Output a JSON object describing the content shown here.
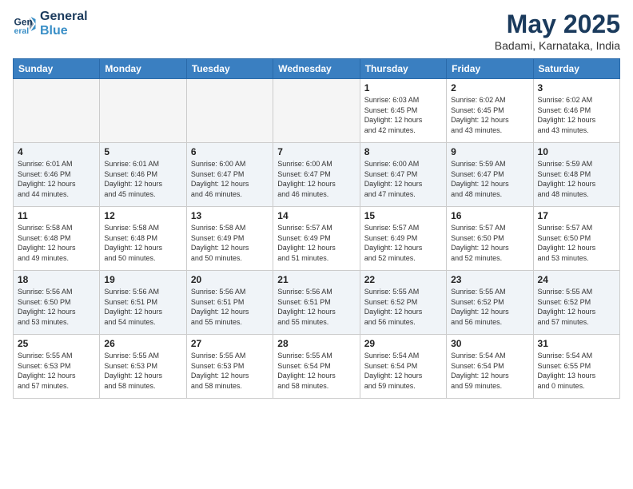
{
  "header": {
    "logo_line1": "General",
    "logo_line2": "Blue",
    "month": "May 2025",
    "location": "Badami, Karnataka, India"
  },
  "weekdays": [
    "Sunday",
    "Monday",
    "Tuesday",
    "Wednesday",
    "Thursday",
    "Friday",
    "Saturday"
  ],
  "weeks": [
    [
      {
        "day": "",
        "info": ""
      },
      {
        "day": "",
        "info": ""
      },
      {
        "day": "",
        "info": ""
      },
      {
        "day": "",
        "info": ""
      },
      {
        "day": "1",
        "info": "Sunrise: 6:03 AM\nSunset: 6:45 PM\nDaylight: 12 hours\nand 42 minutes."
      },
      {
        "day": "2",
        "info": "Sunrise: 6:02 AM\nSunset: 6:45 PM\nDaylight: 12 hours\nand 43 minutes."
      },
      {
        "day": "3",
        "info": "Sunrise: 6:02 AM\nSunset: 6:46 PM\nDaylight: 12 hours\nand 43 minutes."
      }
    ],
    [
      {
        "day": "4",
        "info": "Sunrise: 6:01 AM\nSunset: 6:46 PM\nDaylight: 12 hours\nand 44 minutes."
      },
      {
        "day": "5",
        "info": "Sunrise: 6:01 AM\nSunset: 6:46 PM\nDaylight: 12 hours\nand 45 minutes."
      },
      {
        "day": "6",
        "info": "Sunrise: 6:00 AM\nSunset: 6:47 PM\nDaylight: 12 hours\nand 46 minutes."
      },
      {
        "day": "7",
        "info": "Sunrise: 6:00 AM\nSunset: 6:47 PM\nDaylight: 12 hours\nand 46 minutes."
      },
      {
        "day": "8",
        "info": "Sunrise: 6:00 AM\nSunset: 6:47 PM\nDaylight: 12 hours\nand 47 minutes."
      },
      {
        "day": "9",
        "info": "Sunrise: 5:59 AM\nSunset: 6:47 PM\nDaylight: 12 hours\nand 48 minutes."
      },
      {
        "day": "10",
        "info": "Sunrise: 5:59 AM\nSunset: 6:48 PM\nDaylight: 12 hours\nand 48 minutes."
      }
    ],
    [
      {
        "day": "11",
        "info": "Sunrise: 5:58 AM\nSunset: 6:48 PM\nDaylight: 12 hours\nand 49 minutes."
      },
      {
        "day": "12",
        "info": "Sunrise: 5:58 AM\nSunset: 6:48 PM\nDaylight: 12 hours\nand 50 minutes."
      },
      {
        "day": "13",
        "info": "Sunrise: 5:58 AM\nSunset: 6:49 PM\nDaylight: 12 hours\nand 50 minutes."
      },
      {
        "day": "14",
        "info": "Sunrise: 5:57 AM\nSunset: 6:49 PM\nDaylight: 12 hours\nand 51 minutes."
      },
      {
        "day": "15",
        "info": "Sunrise: 5:57 AM\nSunset: 6:49 PM\nDaylight: 12 hours\nand 52 minutes."
      },
      {
        "day": "16",
        "info": "Sunrise: 5:57 AM\nSunset: 6:50 PM\nDaylight: 12 hours\nand 52 minutes."
      },
      {
        "day": "17",
        "info": "Sunrise: 5:57 AM\nSunset: 6:50 PM\nDaylight: 12 hours\nand 53 minutes."
      }
    ],
    [
      {
        "day": "18",
        "info": "Sunrise: 5:56 AM\nSunset: 6:50 PM\nDaylight: 12 hours\nand 53 minutes."
      },
      {
        "day": "19",
        "info": "Sunrise: 5:56 AM\nSunset: 6:51 PM\nDaylight: 12 hours\nand 54 minutes."
      },
      {
        "day": "20",
        "info": "Sunrise: 5:56 AM\nSunset: 6:51 PM\nDaylight: 12 hours\nand 55 minutes."
      },
      {
        "day": "21",
        "info": "Sunrise: 5:56 AM\nSunset: 6:51 PM\nDaylight: 12 hours\nand 55 minutes."
      },
      {
        "day": "22",
        "info": "Sunrise: 5:55 AM\nSunset: 6:52 PM\nDaylight: 12 hours\nand 56 minutes."
      },
      {
        "day": "23",
        "info": "Sunrise: 5:55 AM\nSunset: 6:52 PM\nDaylight: 12 hours\nand 56 minutes."
      },
      {
        "day": "24",
        "info": "Sunrise: 5:55 AM\nSunset: 6:52 PM\nDaylight: 12 hours\nand 57 minutes."
      }
    ],
    [
      {
        "day": "25",
        "info": "Sunrise: 5:55 AM\nSunset: 6:53 PM\nDaylight: 12 hours\nand 57 minutes."
      },
      {
        "day": "26",
        "info": "Sunrise: 5:55 AM\nSunset: 6:53 PM\nDaylight: 12 hours\nand 58 minutes."
      },
      {
        "day": "27",
        "info": "Sunrise: 5:55 AM\nSunset: 6:53 PM\nDaylight: 12 hours\nand 58 minutes."
      },
      {
        "day": "28",
        "info": "Sunrise: 5:55 AM\nSunset: 6:54 PM\nDaylight: 12 hours\nand 58 minutes."
      },
      {
        "day": "29",
        "info": "Sunrise: 5:54 AM\nSunset: 6:54 PM\nDaylight: 12 hours\nand 59 minutes."
      },
      {
        "day": "30",
        "info": "Sunrise: 5:54 AM\nSunset: 6:54 PM\nDaylight: 12 hours\nand 59 minutes."
      },
      {
        "day": "31",
        "info": "Sunrise: 5:54 AM\nSunset: 6:55 PM\nDaylight: 13 hours\nand 0 minutes."
      }
    ]
  ],
  "colors": {
    "header_bg": "#3a7fc1",
    "alt_row": "#eef2f8",
    "empty_bg": "#f5f5f5"
  }
}
